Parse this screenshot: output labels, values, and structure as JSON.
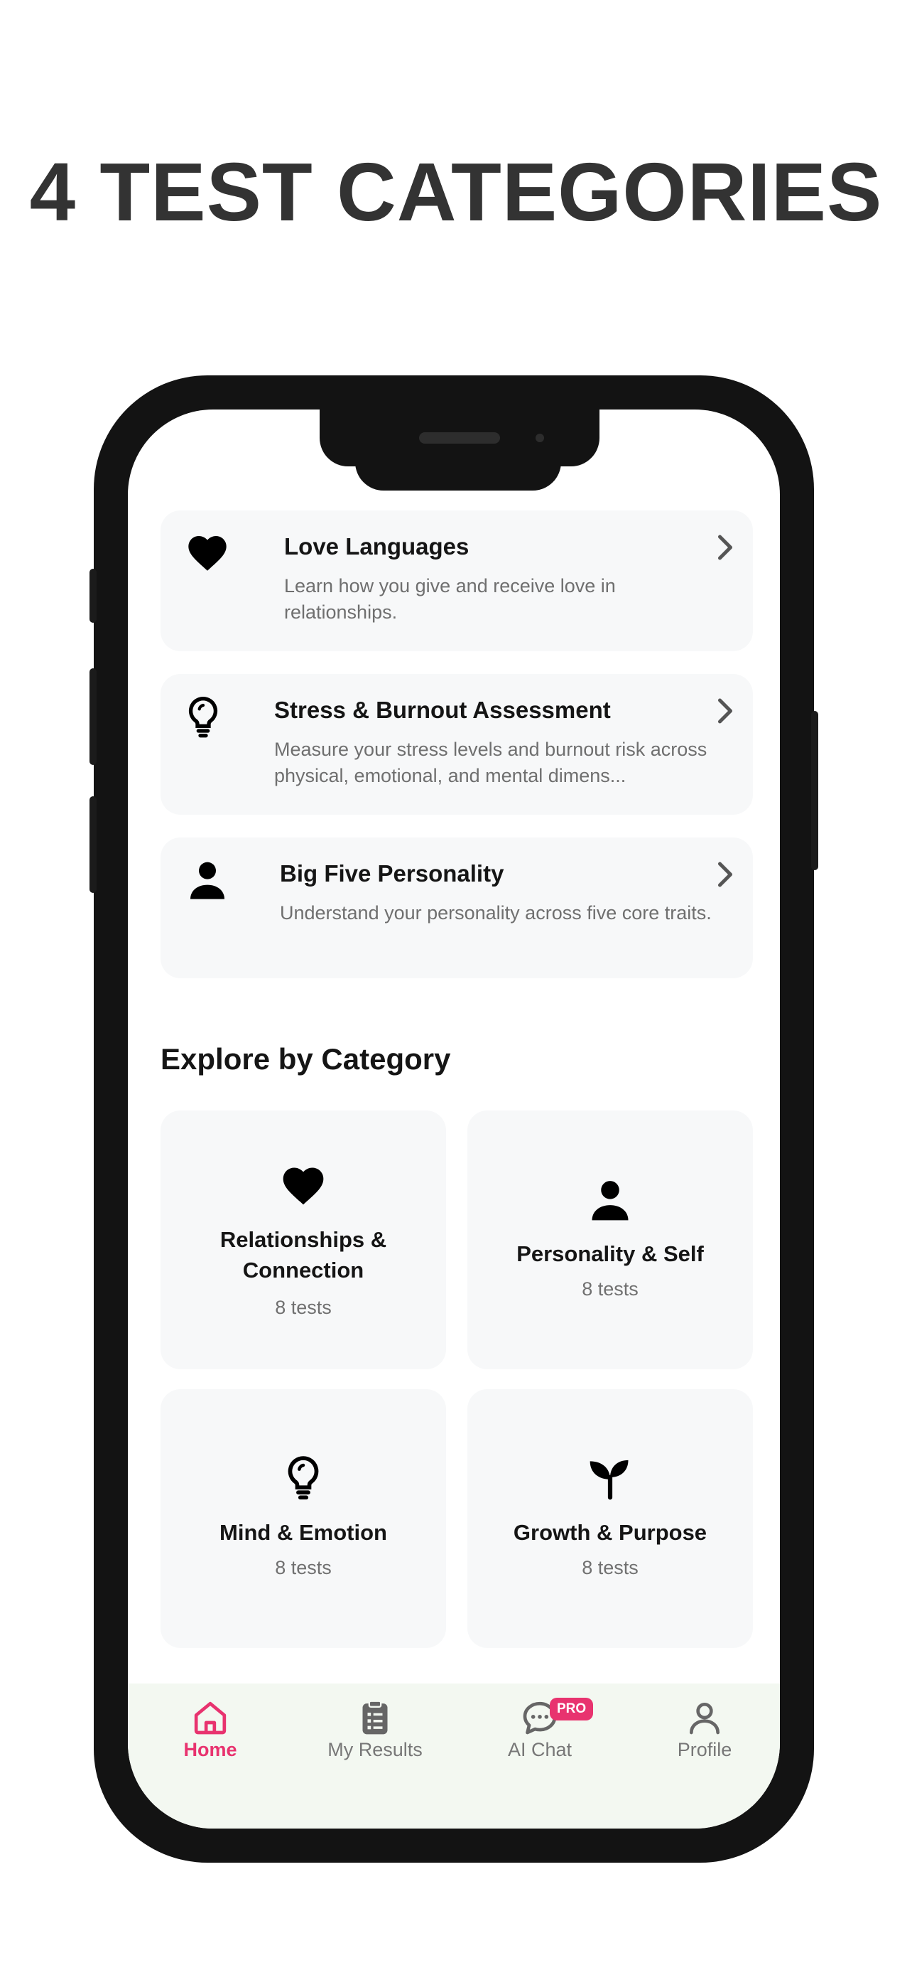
{
  "headline": "4 TEST CATEGORIES",
  "tests": [
    {
      "title": "Love Languages",
      "description": "Learn how you give and receive love in relationships.",
      "icon": "heart-icon"
    },
    {
      "title": "Stress & Burnout Assessment",
      "description": "Measure your stress levels and burnout risk across physical, emotional, and mental dimens...",
      "icon": "lightbulb-icon"
    },
    {
      "title": "Big Five Personality",
      "description": "Understand your personality across five core traits.",
      "icon": "person-icon"
    }
  ],
  "explore": {
    "title": "Explore by Category",
    "categories": [
      {
        "name": "Relationships & Connection",
        "count": "8 tests",
        "icon": "heart-icon"
      },
      {
        "name": "Personality & Self",
        "count": "8 tests",
        "icon": "person-icon"
      },
      {
        "name": "Mind & Emotion",
        "count": "8 tests",
        "icon": "lightbulb-icon"
      },
      {
        "name": "Growth & Purpose",
        "count": "8 tests",
        "icon": "sprout-icon"
      }
    ]
  },
  "nav": {
    "items": [
      {
        "label": "Home",
        "icon": "home-icon",
        "active": true
      },
      {
        "label": "My Results",
        "icon": "clipboard-icon",
        "active": false
      },
      {
        "label": "AI Chat",
        "icon": "chat-icon",
        "active": false,
        "badge": "PRO"
      },
      {
        "label": "Profile",
        "icon": "user-icon",
        "active": false
      }
    ]
  },
  "colors": {
    "accent": "#e8336f",
    "card": "#f7f8f9",
    "nav_bg": "#f3f8f1",
    "heading": "#333333"
  }
}
